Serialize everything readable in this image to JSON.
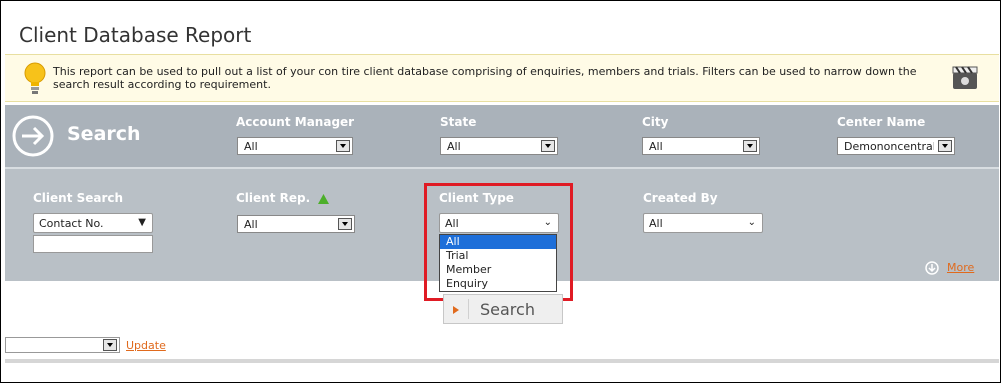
{
  "page": {
    "title": "Client Database Report",
    "notice": "This report can be used to pull out a list of your con tire client database comprising of enquiries, members and trials. Filters can be used to narrow down the search result according to requirement.",
    "notice_icon": "lightbulb-icon",
    "video_icon": "video-clapper-icon"
  },
  "search_panel": {
    "title": "Search",
    "icon": "arrow-right-circle-icon",
    "filters_row1": {
      "account_manager": {
        "label": "Account Manager",
        "value": "All"
      },
      "state": {
        "label": "State",
        "value": "All"
      },
      "city": {
        "label": "City",
        "value": "All"
      },
      "center_name": {
        "label": "Center Name",
        "value": "Demononcentral"
      }
    },
    "filters_row2": {
      "client_search": {
        "label": "Client Search",
        "value": "Contact No.",
        "input_value": ""
      },
      "client_rep": {
        "label": "Client Rep.",
        "value": "All",
        "icon": "up-triangle-icon"
      },
      "client_type": {
        "label": "Client Type",
        "value": "All",
        "options": [
          "All",
          "Trial",
          "Member",
          "Enquiry"
        ],
        "selected_index": 0
      },
      "created_by": {
        "label": "Created By",
        "value": "All"
      }
    },
    "more_link": "More",
    "more_icon": "down-arrow-circle-icon",
    "search_button": "Search"
  },
  "bottom": {
    "select_value": "",
    "update_link": "Update"
  },
  "colors": {
    "panel": "#b9c0c6",
    "accent_link": "#e06a1d",
    "highlight": "#e01b24",
    "selected_option": "#1e6fd9"
  }
}
